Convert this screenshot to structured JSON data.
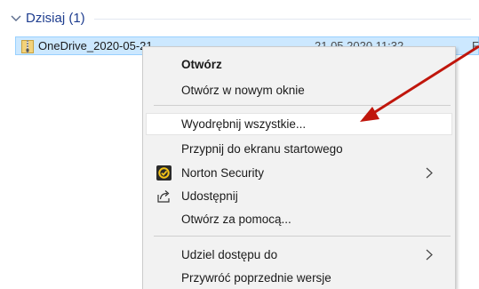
{
  "group": {
    "title": "Dzisiaj (1)"
  },
  "file": {
    "name": "OneDrive_2020-05-21",
    "date": "21.05.2020 11:32",
    "type": "F"
  },
  "menu": {
    "open": "Otwórz",
    "open_new_window": "Otwórz w nowym oknie",
    "extract_all": "Wyodrębnij wszystkie...",
    "pin_start": "Przypnij do ekranu startowego",
    "norton": "Norton Security",
    "share": "Udostępnij",
    "open_with": "Otwórz za pomocą...",
    "give_access": "Udziel dostępu do",
    "restore_versions": "Przywróć poprzednie wersje"
  },
  "colors": {
    "selection": "#cce8ff",
    "annotation_arrow": "#c0160c",
    "group_title": "#1e3d8f"
  },
  "icons": [
    "chevron-down-icon",
    "zip-folder-icon",
    "norton-icon",
    "share-icon",
    "chevron-right-icon"
  ]
}
